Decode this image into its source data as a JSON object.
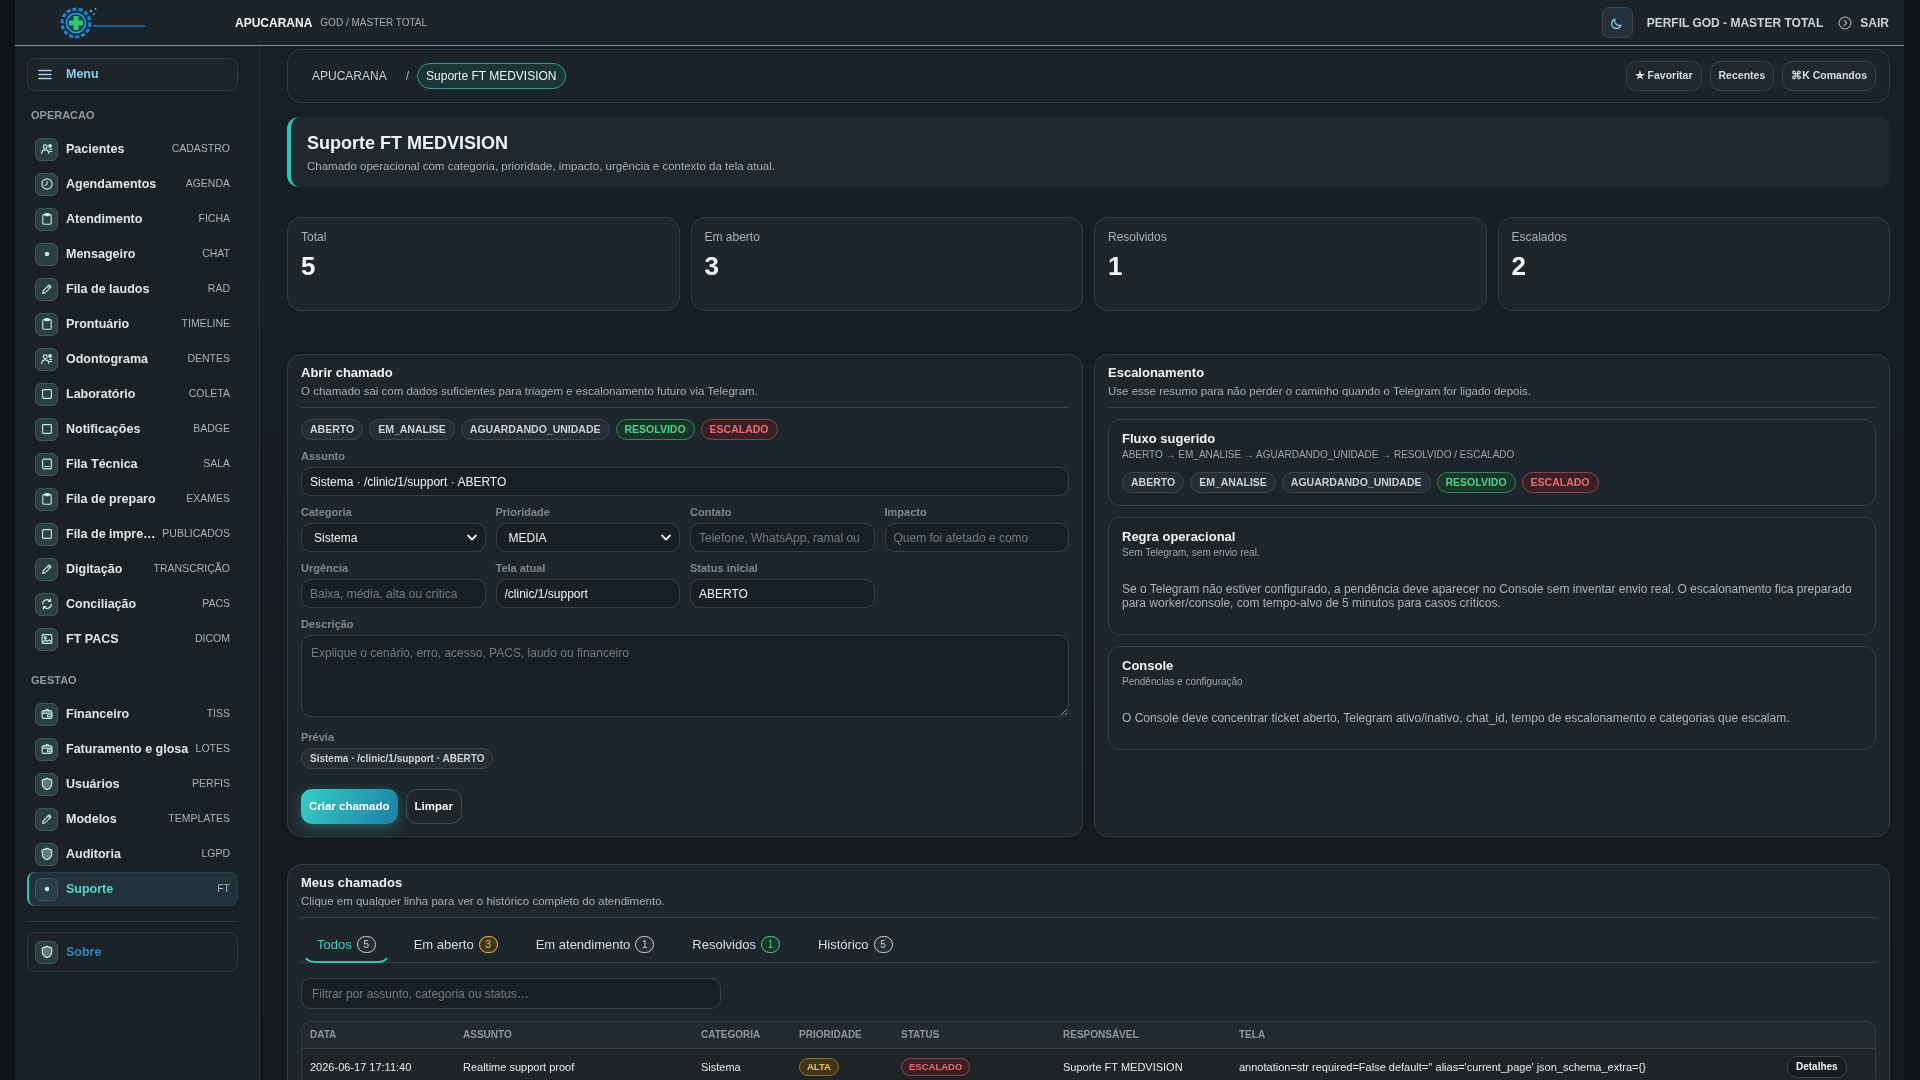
{
  "header": {
    "brand": "APUCARANA",
    "role": "GOD / MASTER TOTAL",
    "profile": "PERFIL GOD - MASTER TOTAL",
    "logout": "SAIR"
  },
  "sidebar": {
    "menu_label": "Menu",
    "sections": [
      {
        "title": "OPERACAO",
        "items": [
          {
            "label": "Pacientes",
            "tag": "CADASTRO",
            "selected": false
          },
          {
            "label": "Agendamentos",
            "tag": "AGENDA",
            "selected": false
          },
          {
            "label": "Atendimento",
            "tag": "FICHA",
            "selected": false
          },
          {
            "label": "Mensageiro",
            "tag": "CHAT",
            "selected": false
          },
          {
            "label": "Fila de laudos",
            "tag": "RAD",
            "selected": false
          },
          {
            "label": "Prontuário",
            "tag": "TIMELINE",
            "selected": false
          },
          {
            "label": "Odontograma",
            "tag": "DENTES",
            "selected": false
          },
          {
            "label": "Laboratório",
            "tag": "COLETA",
            "selected": false
          },
          {
            "label": "Notificações",
            "tag": "BADGE",
            "selected": false
          },
          {
            "label": "Fila Técnica",
            "tag": "SALA",
            "selected": false
          },
          {
            "label": "Fila de preparo",
            "tag": "EXAMES",
            "selected": false
          },
          {
            "label": "Fila de impre…",
            "tag": "PUBLICADOS",
            "selected": false
          },
          {
            "label": "Digitação",
            "tag": "TRANSCRIÇÃO",
            "selected": false
          },
          {
            "label": "Conciliação",
            "tag": "PACS",
            "selected": false
          },
          {
            "label": "FT PACS",
            "tag": "DICOM",
            "selected": false
          }
        ]
      },
      {
        "title": "GESTAO",
        "items": [
          {
            "label": "Financeiro",
            "tag": "TISS",
            "selected": false
          },
          {
            "label": "Faturamento e glosa",
            "tag": "LOTES",
            "selected": false
          },
          {
            "label": "Usuários",
            "tag": "PERFIS",
            "selected": false
          },
          {
            "label": "Modelos",
            "tag": "TEMPLATES",
            "selected": false
          },
          {
            "label": "Auditoria",
            "tag": "LGPD",
            "selected": false
          },
          {
            "label": "Suporte",
            "tag": "FT",
            "selected": true
          }
        ]
      }
    ],
    "footer_item": "Sobre"
  },
  "breadcrumb": {
    "items": [
      {
        "label": "APUCARANA",
        "selected": false
      },
      {
        "label": "Suporte FT MEDVISION",
        "selected": true
      }
    ],
    "separator": "/",
    "actions": [
      "★ Favoritar",
      "Recentes",
      "⌘K Comandos"
    ]
  },
  "page": {
    "title": "Suporte FT MEDVISION",
    "subtitle": "Chamado operacional com categoria, prioridade, impacto, urgência e contexto da tela atual."
  },
  "stats": [
    {
      "label": "Total",
      "value": "5"
    },
    {
      "label": "Em aberto",
      "value": "3"
    },
    {
      "label": "Resolvidos",
      "value": "1"
    },
    {
      "label": "Escalados",
      "value": "2"
    }
  ],
  "form": {
    "title": "Abrir chamado",
    "subtitle": "O chamado sai com dados suficientes para triagem e escalonamento futuro via Telegram.",
    "status_pills": [
      {
        "label": "ABERTO",
        "kind": "neutral"
      },
      {
        "label": "EM_ANALISE",
        "kind": "neutral"
      },
      {
        "label": "AGUARDANDO_UNIDADE",
        "kind": "neutral"
      },
      {
        "label": "RESOLVIDO",
        "kind": "success"
      },
      {
        "label": "ESCALADO",
        "kind": "danger"
      }
    ],
    "subject": {
      "label": "Assunto",
      "value": "Sistema · /clinic/1/support · ABERTO"
    },
    "field_rows": [
      [
        {
          "label": "Categoria",
          "kind": "select",
          "value": "Sistema"
        },
        {
          "label": "Prioridade",
          "kind": "select",
          "value": "MEDIA"
        },
        {
          "label": "Contato",
          "kind": "input",
          "placeholder": "Telefone, WhatsApp, ramal ou"
        },
        {
          "label": "Impacto",
          "kind": "input",
          "placeholder": "Quem foi afetado e como"
        }
      ],
      [
        {
          "label": "Urgência",
          "kind": "input",
          "placeholder": "Baixa, média, alta ou crítica"
        },
        {
          "label": "Tela atual",
          "kind": "input",
          "value": "/clinic/1/support"
        },
        {
          "label": "Status inicial",
          "kind": "input",
          "value": "ABERTO"
        }
      ]
    ],
    "description": {
      "label": "Descrição",
      "placeholder": "Explique o cenário, erro, acesso, PACS, laudo ou financeiro"
    },
    "preview": {
      "label": "Prévia",
      "value": "Sistema · /clinic/1/support · ABERTO"
    },
    "buttons": [
      {
        "label": "Criar chamado",
        "kind": "primary"
      },
      {
        "label": "Limpar",
        "kind": "secondary"
      }
    ]
  },
  "escalation": {
    "title": "Escalonamento",
    "subtitle": "Use esse resumo para não perder o caminho quando o Telegram for ligado depois.",
    "panels": [
      {
        "title": "Fluxo sugerido",
        "subtitle": "ABERTO → EM_ANALISE → AGUARDANDO_UNIDADE → RESOLVIDO / ESCALADO",
        "pills": [
          {
            "label": "ABERTO",
            "kind": "neutral"
          },
          {
            "label": "EM_ANALISE",
            "kind": "neutral"
          },
          {
            "label": "AGUARDANDO_UNIDADE",
            "kind": "neutral"
          },
          {
            "label": "RESOLVIDO",
            "kind": "success"
          },
          {
            "label": "ESCALADO",
            "kind": "danger"
          }
        ]
      },
      {
        "title": "Regra operacional",
        "subtitle": "Sem Telegram, sem envio real.",
        "body": "Se o Telegram não estiver configurado, a pendência deve aparecer no Console sem inventar envio real. O escalonamento fica preparado para worker/console, com tempo-alvo de 5 minutos para casos críticos."
      },
      {
        "title": "Console",
        "subtitle": "Pendências e configuração",
        "body": "O Console deve concentrar ticket aberto, Telegram ativo/inativo, chat_id, tempo de escalonamento e categorias que escalam."
      }
    ]
  },
  "tickets": {
    "title": "Meus chamados",
    "subtitle": "Clique em qualquer linha para ver o histórico completo do atendimento.",
    "tabs": [
      {
        "label": "Todos",
        "count": "5",
        "kind": "neutral",
        "selected": true
      },
      {
        "label": "Em aberto",
        "count": "3",
        "kind": "warning",
        "selected": false
      },
      {
        "label": "Em atendimento",
        "count": "1",
        "kind": "neutral",
        "selected": false
      },
      {
        "label": "Resolvidos",
        "count": "1",
        "kind": "success",
        "selected": false
      },
      {
        "label": "Histórico",
        "count": "5",
        "kind": "neutral",
        "selected": false
      }
    ],
    "filter": {
      "placeholder": "Filtrar por assunto, categoria ou status…"
    },
    "table": {
      "columns": [
        "DATA",
        "ASSUNTO",
        "CATEGORIA",
        "PRIORIDADE",
        "STATUS",
        "RESPONSÁVEL",
        "TELA"
      ],
      "rows": [
        {
          "date": "2026-06-17 17:11:40",
          "subject": "Realtime support proof",
          "category": "Sistema",
          "priority": {
            "label": "ALTA",
            "kind": "warning"
          },
          "status": {
            "label": "ESCALADO",
            "kind": "danger"
          },
          "owner": "Suporte FT MEDVISION",
          "screen": "annotation=str required=False default='' alias='current_page' json_schema_extra={}",
          "action": "Detalhes"
        }
      ]
    }
  }
}
